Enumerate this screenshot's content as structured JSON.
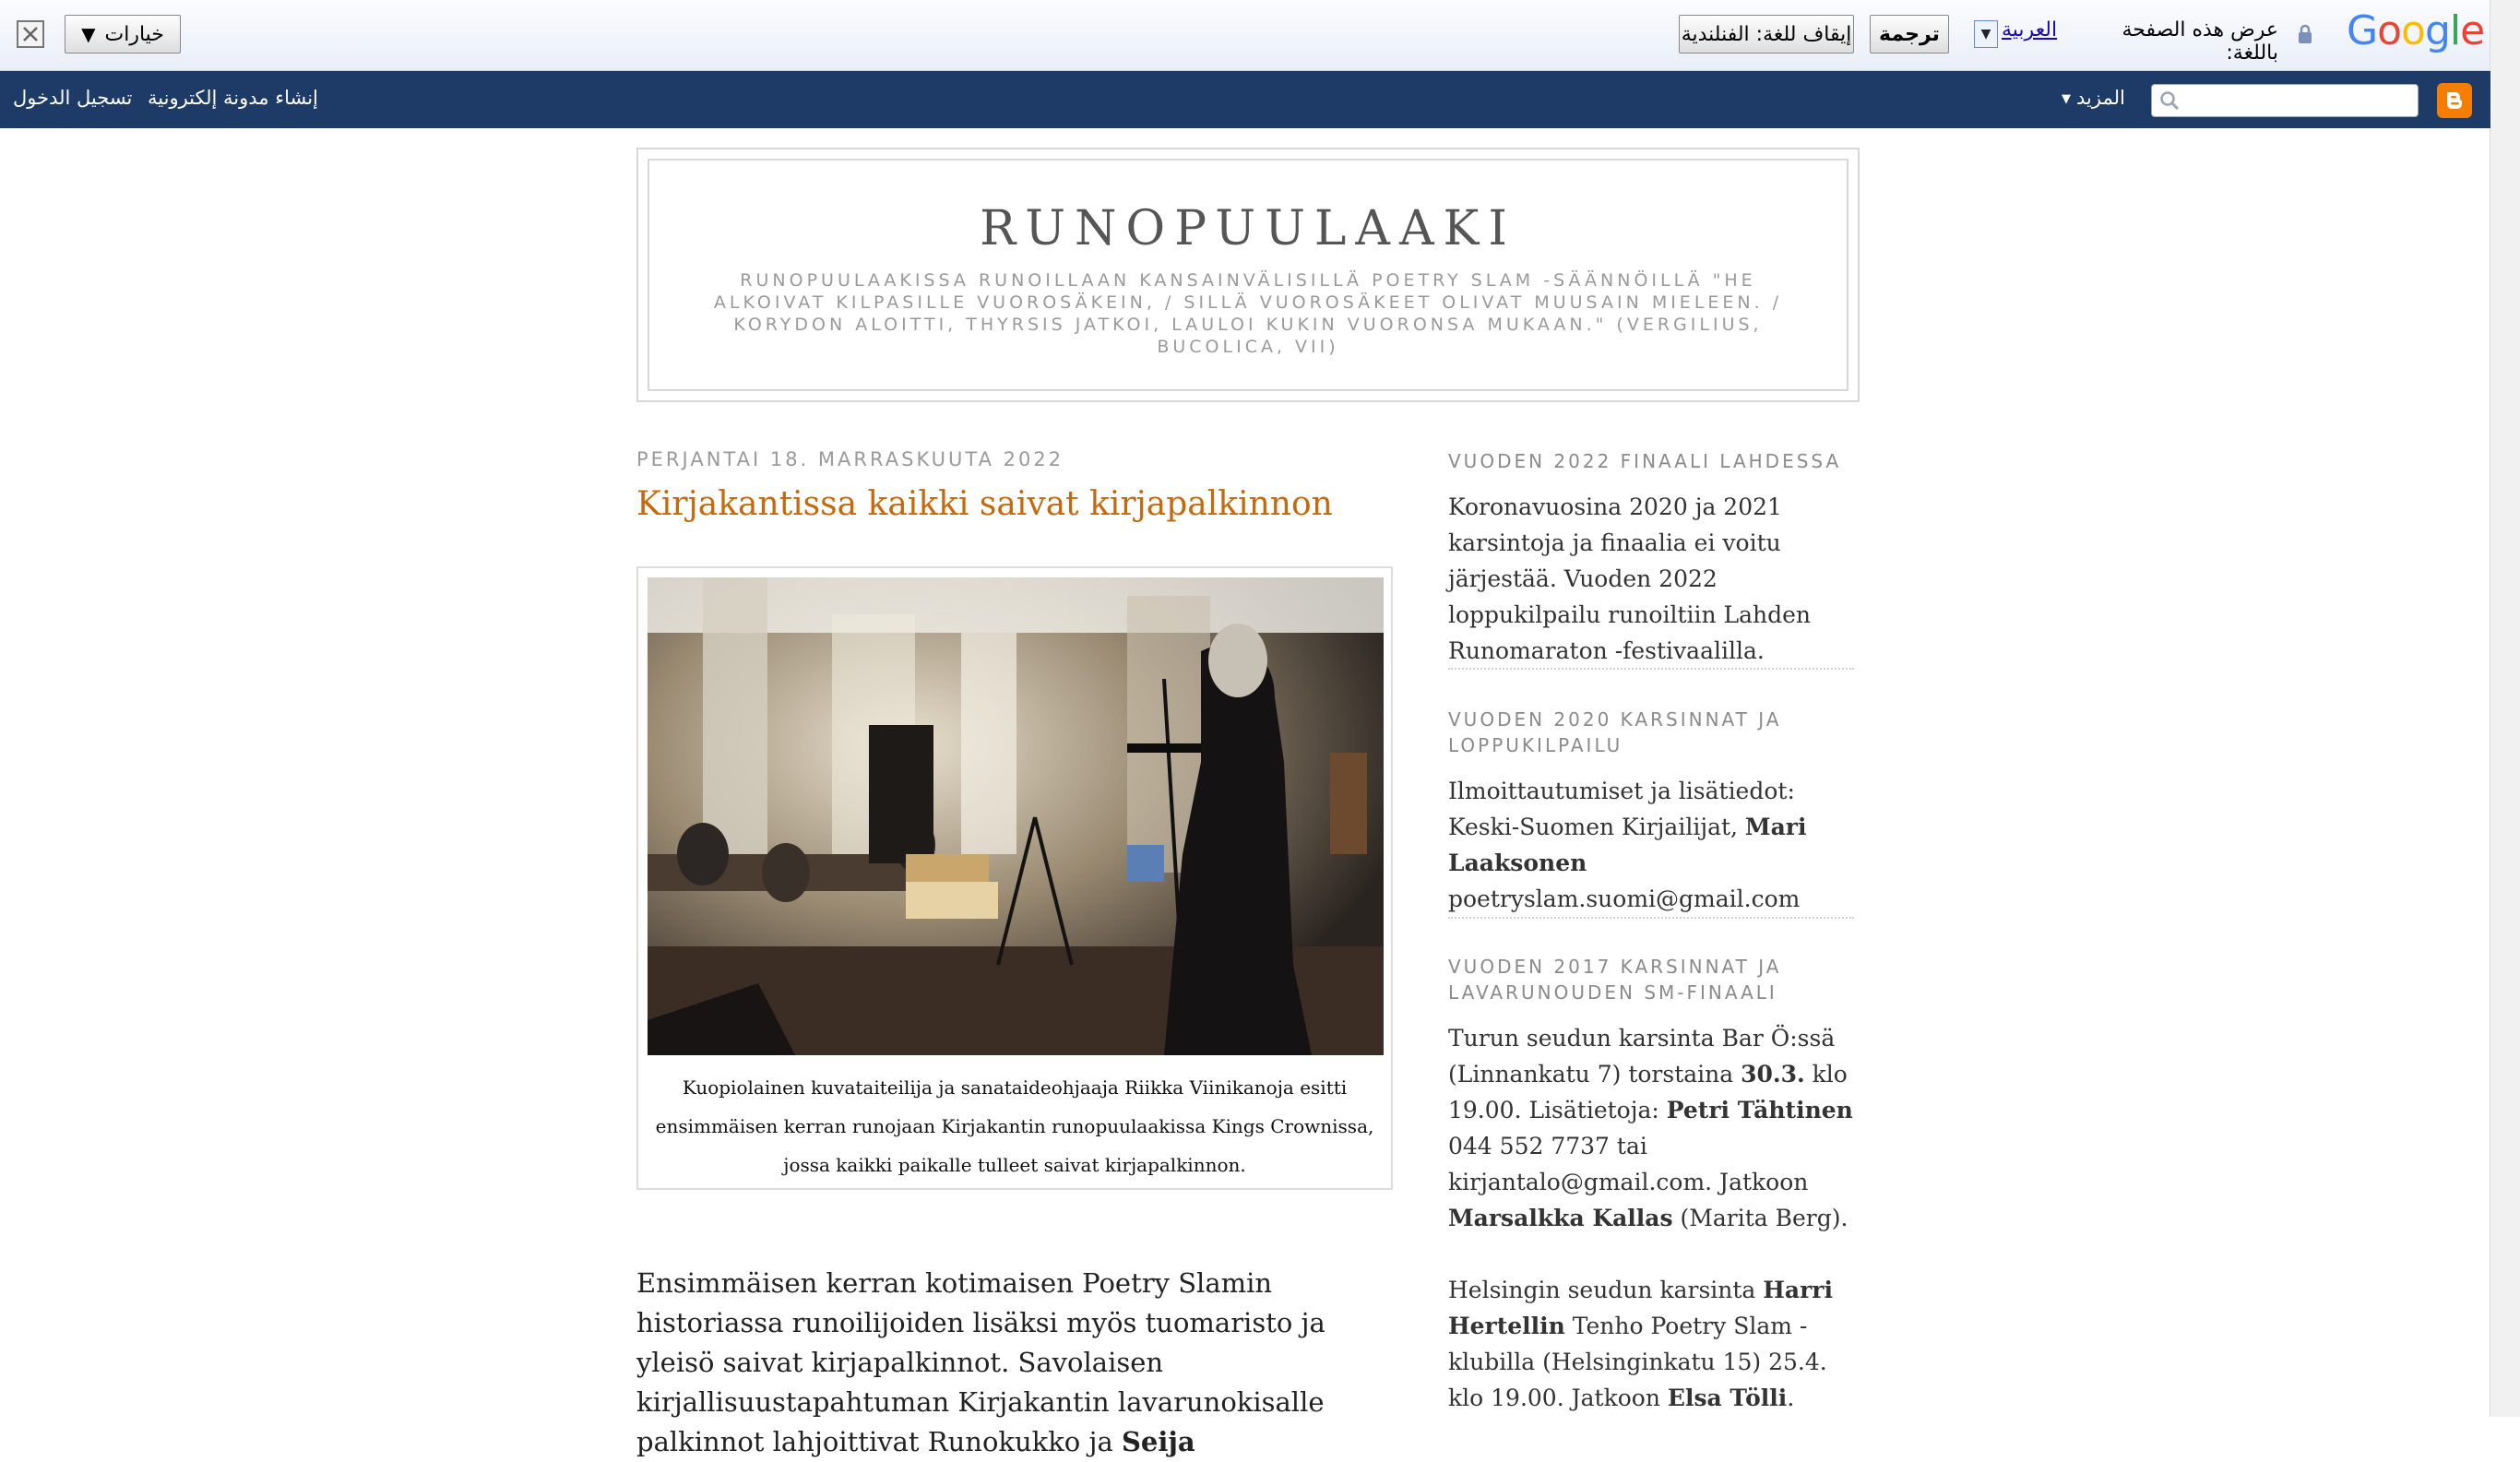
{
  "translate_bar": {
    "options_label": "خيارات",
    "stop_label": "إيقاف للغة: الفنلندية",
    "translate_label": "ترجمة",
    "language": "العربية",
    "prompt": "عرض هذه الصفحة باللغة:",
    "logo": [
      "G",
      "o",
      "o",
      "g",
      "l",
      "e"
    ],
    "logo_colors": [
      "#4285F4",
      "#EA4335",
      "#FBBC05",
      "#4285F4",
      "#34A853",
      "#EA4335"
    ]
  },
  "navbar": {
    "login": "تسجيل الدخول",
    "create_blog": "إنشاء مدونة إلكترونية",
    "more": "المزيد",
    "search_placeholder": ""
  },
  "header": {
    "title": "RUNOPUULAAKI",
    "description": "RUNOPUULAAKISSA runoillaan kansainvälisillä POETRY SLAM -säännöillä \"He alkoivat kilpasille vuorosäkein, / sillä vuorosäkeet olivat Muusain mieleen. / Korydon aloitti, Thyrsis jatkoi, lauloi kukin vuoronsa mukaan.\" (Vergilius, Bucolica, VII)"
  },
  "post": {
    "date": "PERJANTAI 18. MARRASKUUTA 2022",
    "title": "Kirjakantissa kaikki saivat kirjapalkinnon",
    "caption": "Kuopiolainen kuvataiteilija ja sanataideohjaaja Riikka Viinikanoja esitti ensimmäisen kerran runojaan Kirjakantin runopuulaakissa Kings Crownissa, jossa kaikki paikalle tulleet saivat kirjapalkinnon.",
    "body": "Ensimmäisen kerran kotimaisen Poetry Slamin historiassa runoilijoiden lisäksi myös tuomaristo ja yleisö saivat kirjapalkinnot. Savolaisen kirjallisuustapahtuman Kirjakantin lavarunokisalle palkinnot lahjoittivat Runokukko ja",
    "body_bold": "Seija"
  },
  "sidebar": {
    "s1_heading": "VUODEN 2022 FINAALI LAHDESSA",
    "s1_text": "Koronavuosina 2020 ja 2021 karsintoja ja finaalia ei voitu järjestää. Vuoden 2022 loppukilpailu runoiltiin Lahden Runomaraton -festivaalilla.",
    "s2_heading": "VUODEN 2020 KARSINNAT JA LOPPUKILPAILU",
    "s2_text_a": "Ilmoittautumiset ja lisätiedot: Keski-Suomen Kirjailijat, ",
    "s2_bold": "Mari Laaksonen",
    "s2_email": "poetryslam.suomi@gmail.com",
    "s3_heading": "VUODEN 2017 KARSINNAT JA LAVARUNOUDEN SM-FINAALI",
    "s3_p1_a": "Turun seudun karsinta Bar Ö:ssä (Linnankatu 7) torstaina ",
    "s3_p1_b1": "30.3.",
    "s3_p1_c": " klo 19.00. Lisätietoja: ",
    "s3_p1_b2": "Petri Tähtinen",
    "s3_p1_d": " 044 552 7737 tai kirjantalo@gmail.com. Jatkoon ",
    "s3_p1_b3": "Marsalkka Kallas",
    "s3_p1_e": " (Marita Berg).",
    "s3_p2_a": "Helsingin seudun karsinta ",
    "s3_p2_b1": "Harri Hertellin",
    "s3_p2_c": " Tenho Poetry Slam -klubilla (Helsinginkatu 15) 25.4. klo 19.00. Jatkoon ",
    "s3_p2_b2": "Elsa Tölli",
    "s3_p2_d": "."
  }
}
